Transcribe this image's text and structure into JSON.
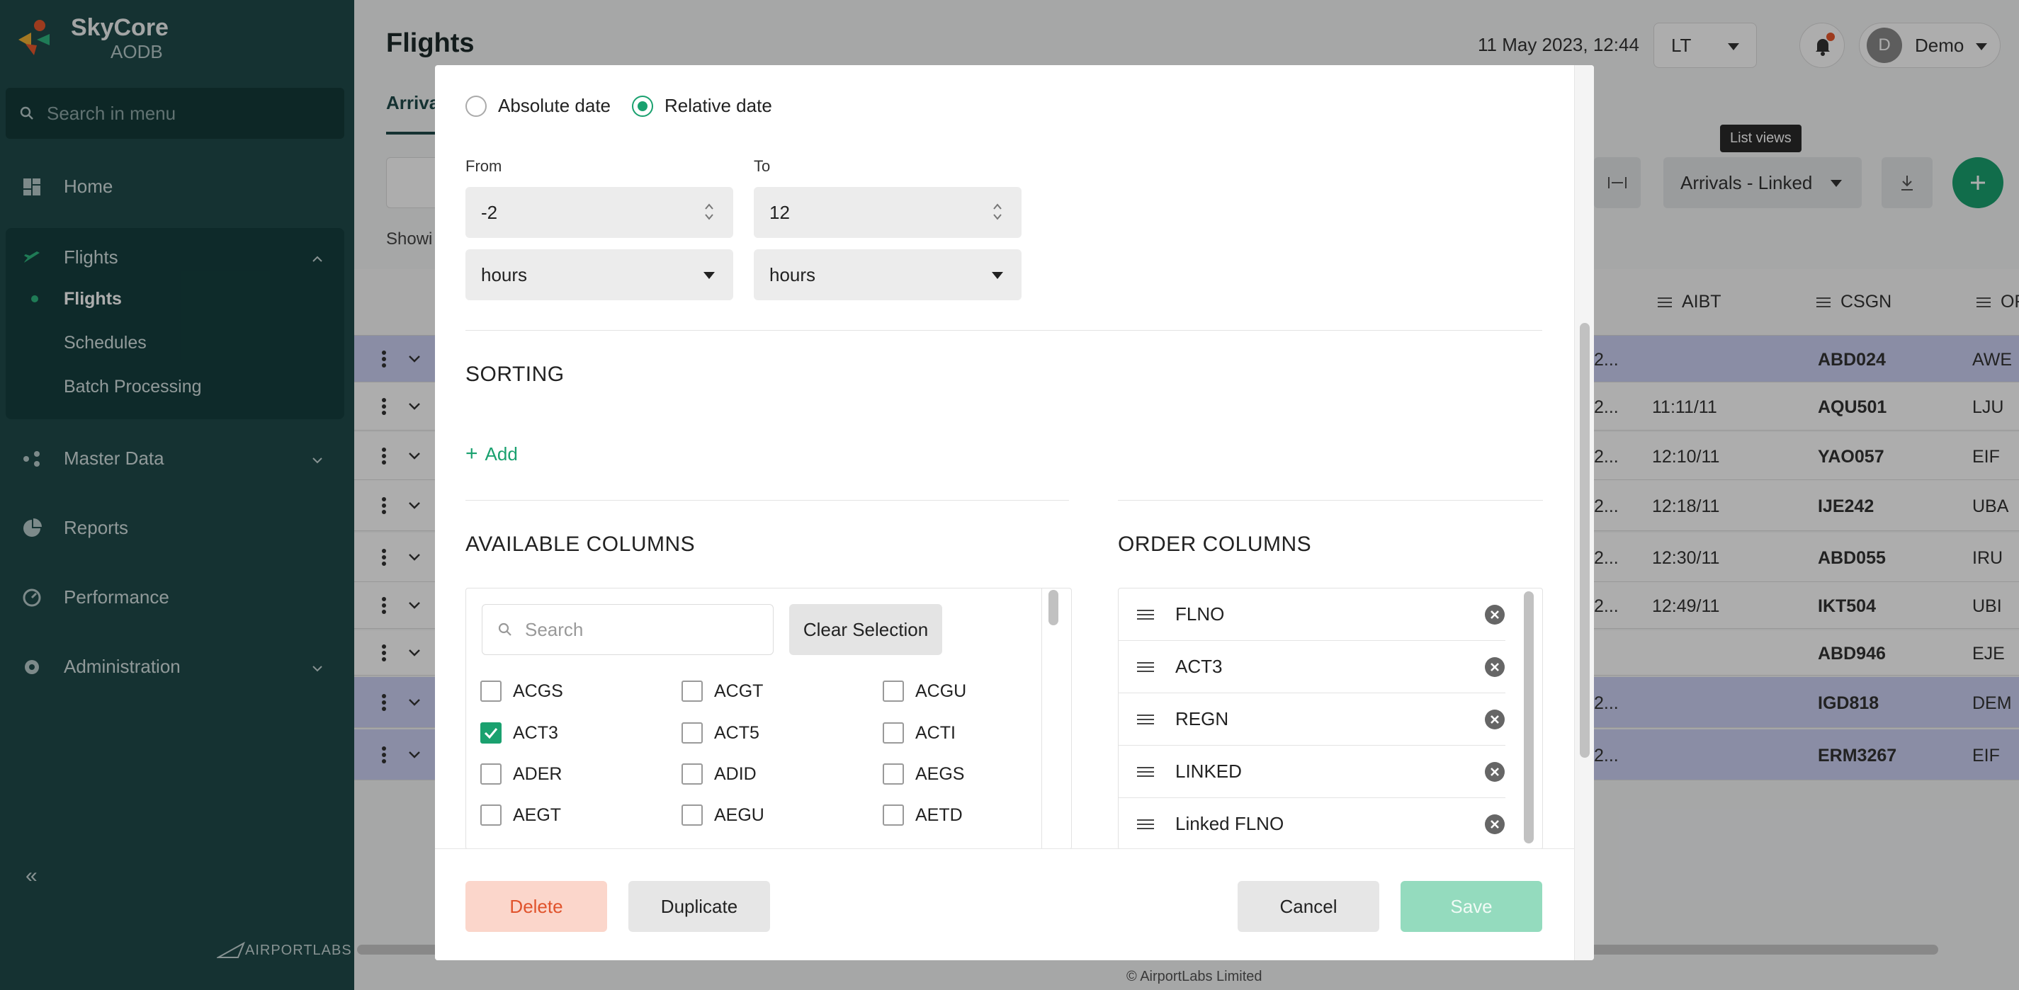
{
  "app": {
    "name": "SkyCore",
    "sub": "AODB",
    "brand_footer": "AIRPORTLABS"
  },
  "sidebar": {
    "search_placeholder": "Search in menu",
    "items": [
      {
        "label": "Home"
      },
      {
        "label": "Flights"
      },
      {
        "label": "Master Data"
      },
      {
        "label": "Reports"
      },
      {
        "label": "Performance"
      },
      {
        "label": "Administration"
      }
    ],
    "flights_sub": [
      "Flights",
      "Schedules",
      "Batch Processing"
    ],
    "collapse": "«"
  },
  "header": {
    "title": "Flights",
    "datetime": "11 May 2023, 12:44",
    "timezone": "LT",
    "user_initial": "D",
    "user_name": "Demo",
    "tab_active": "Arriva",
    "tooltip": "List views",
    "view_selected": "Arrivals - Linked",
    "showing": "Showi"
  },
  "table": {
    "headers": [
      "AIBT",
      "CSGN",
      "OF"
    ],
    "rows": [
      {
        "c1": "2...",
        "aibt": "",
        "csgn": "ABD024",
        "org": "AWE",
        "highlight": true
      },
      {
        "c1": "2...",
        "aibt": "11:11/11",
        "csgn": "AQU501",
        "org": "LJU",
        "highlight": false
      },
      {
        "c1": "2...",
        "aibt": "12:10/11",
        "csgn": "YAO057",
        "org": "EIF",
        "highlight": false
      },
      {
        "c1": "2...",
        "aibt": "12:18/11",
        "csgn": "IJE242",
        "org": "UBA",
        "highlight": false
      },
      {
        "c1": "2...",
        "aibt": "12:30/11",
        "csgn": "ABD055",
        "org": "IRU",
        "highlight": false
      },
      {
        "c1": "2...",
        "aibt": "12:49/11",
        "csgn": "IKT504",
        "org": "UBI",
        "highlight": false
      },
      {
        "c1": "",
        "aibt": "",
        "csgn": "ABD946",
        "org": "EJE",
        "highlight": false
      },
      {
        "c1": "2...",
        "aibt": "",
        "csgn": "IGD818",
        "org": "DEM",
        "highlight": true
      },
      {
        "c1": "2...",
        "aibt": "",
        "csgn": "ERM3267",
        "org": "EIF",
        "highlight": true
      }
    ]
  },
  "footer": "© AirportLabs Limited",
  "modal": {
    "date_mode": {
      "absolute": "Absolute date",
      "relative": "Relative date",
      "selected": "relative"
    },
    "from": {
      "label": "From",
      "value": "-2",
      "unit": "hours"
    },
    "to": {
      "label": "To",
      "value": "12",
      "unit": "hours"
    },
    "sorting": {
      "title": "SORTING",
      "add": "Add"
    },
    "available": {
      "title": "AVAILABLE COLUMNS",
      "search_placeholder": "Search",
      "clear": "Clear Selection",
      "columns": [
        {
          "label": "ACGS",
          "checked": false
        },
        {
          "label": "ACGT",
          "checked": false
        },
        {
          "label": "ACGU",
          "checked": false
        },
        {
          "label": "ACT3",
          "checked": true
        },
        {
          "label": "ACT5",
          "checked": false
        },
        {
          "label": "ACTI",
          "checked": false
        },
        {
          "label": "ADER",
          "checked": false
        },
        {
          "label": "ADID",
          "checked": false
        },
        {
          "label": "AEGS",
          "checked": false
        },
        {
          "label": "AEGT",
          "checked": false
        },
        {
          "label": "AEGU",
          "checked": false
        },
        {
          "label": "AETD",
          "checked": false
        }
      ]
    },
    "order": {
      "title": "ORDER COLUMNS",
      "items": [
        "FLNO",
        "ACT3",
        "REGN",
        "LINKED",
        "Linked FLNO"
      ]
    },
    "buttons": {
      "delete": "Delete",
      "duplicate": "Duplicate",
      "cancel": "Cancel",
      "save": "Save"
    }
  },
  "colors": {
    "sidebar": "#1f4a4a",
    "accent": "#1aa16f",
    "danger": "#e0532c",
    "row_highlight": "#ccd0f4"
  }
}
